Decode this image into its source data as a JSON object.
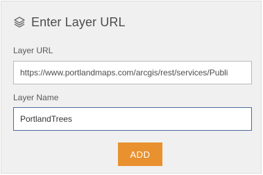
{
  "header": {
    "icon": "layers-icon",
    "title": "Enter Layer URL"
  },
  "form": {
    "url_label": "Layer URL",
    "url_value": "https://www.portlandmaps.com/arcgis/rest/services/Publi",
    "name_label": "Layer Name",
    "name_value": "PortlandTrees",
    "add_label": "ADD"
  },
  "colors": {
    "panel_bg": "#f0f0f0",
    "button_bg": "#e8912e",
    "focused_border": "#4a6a9a"
  }
}
